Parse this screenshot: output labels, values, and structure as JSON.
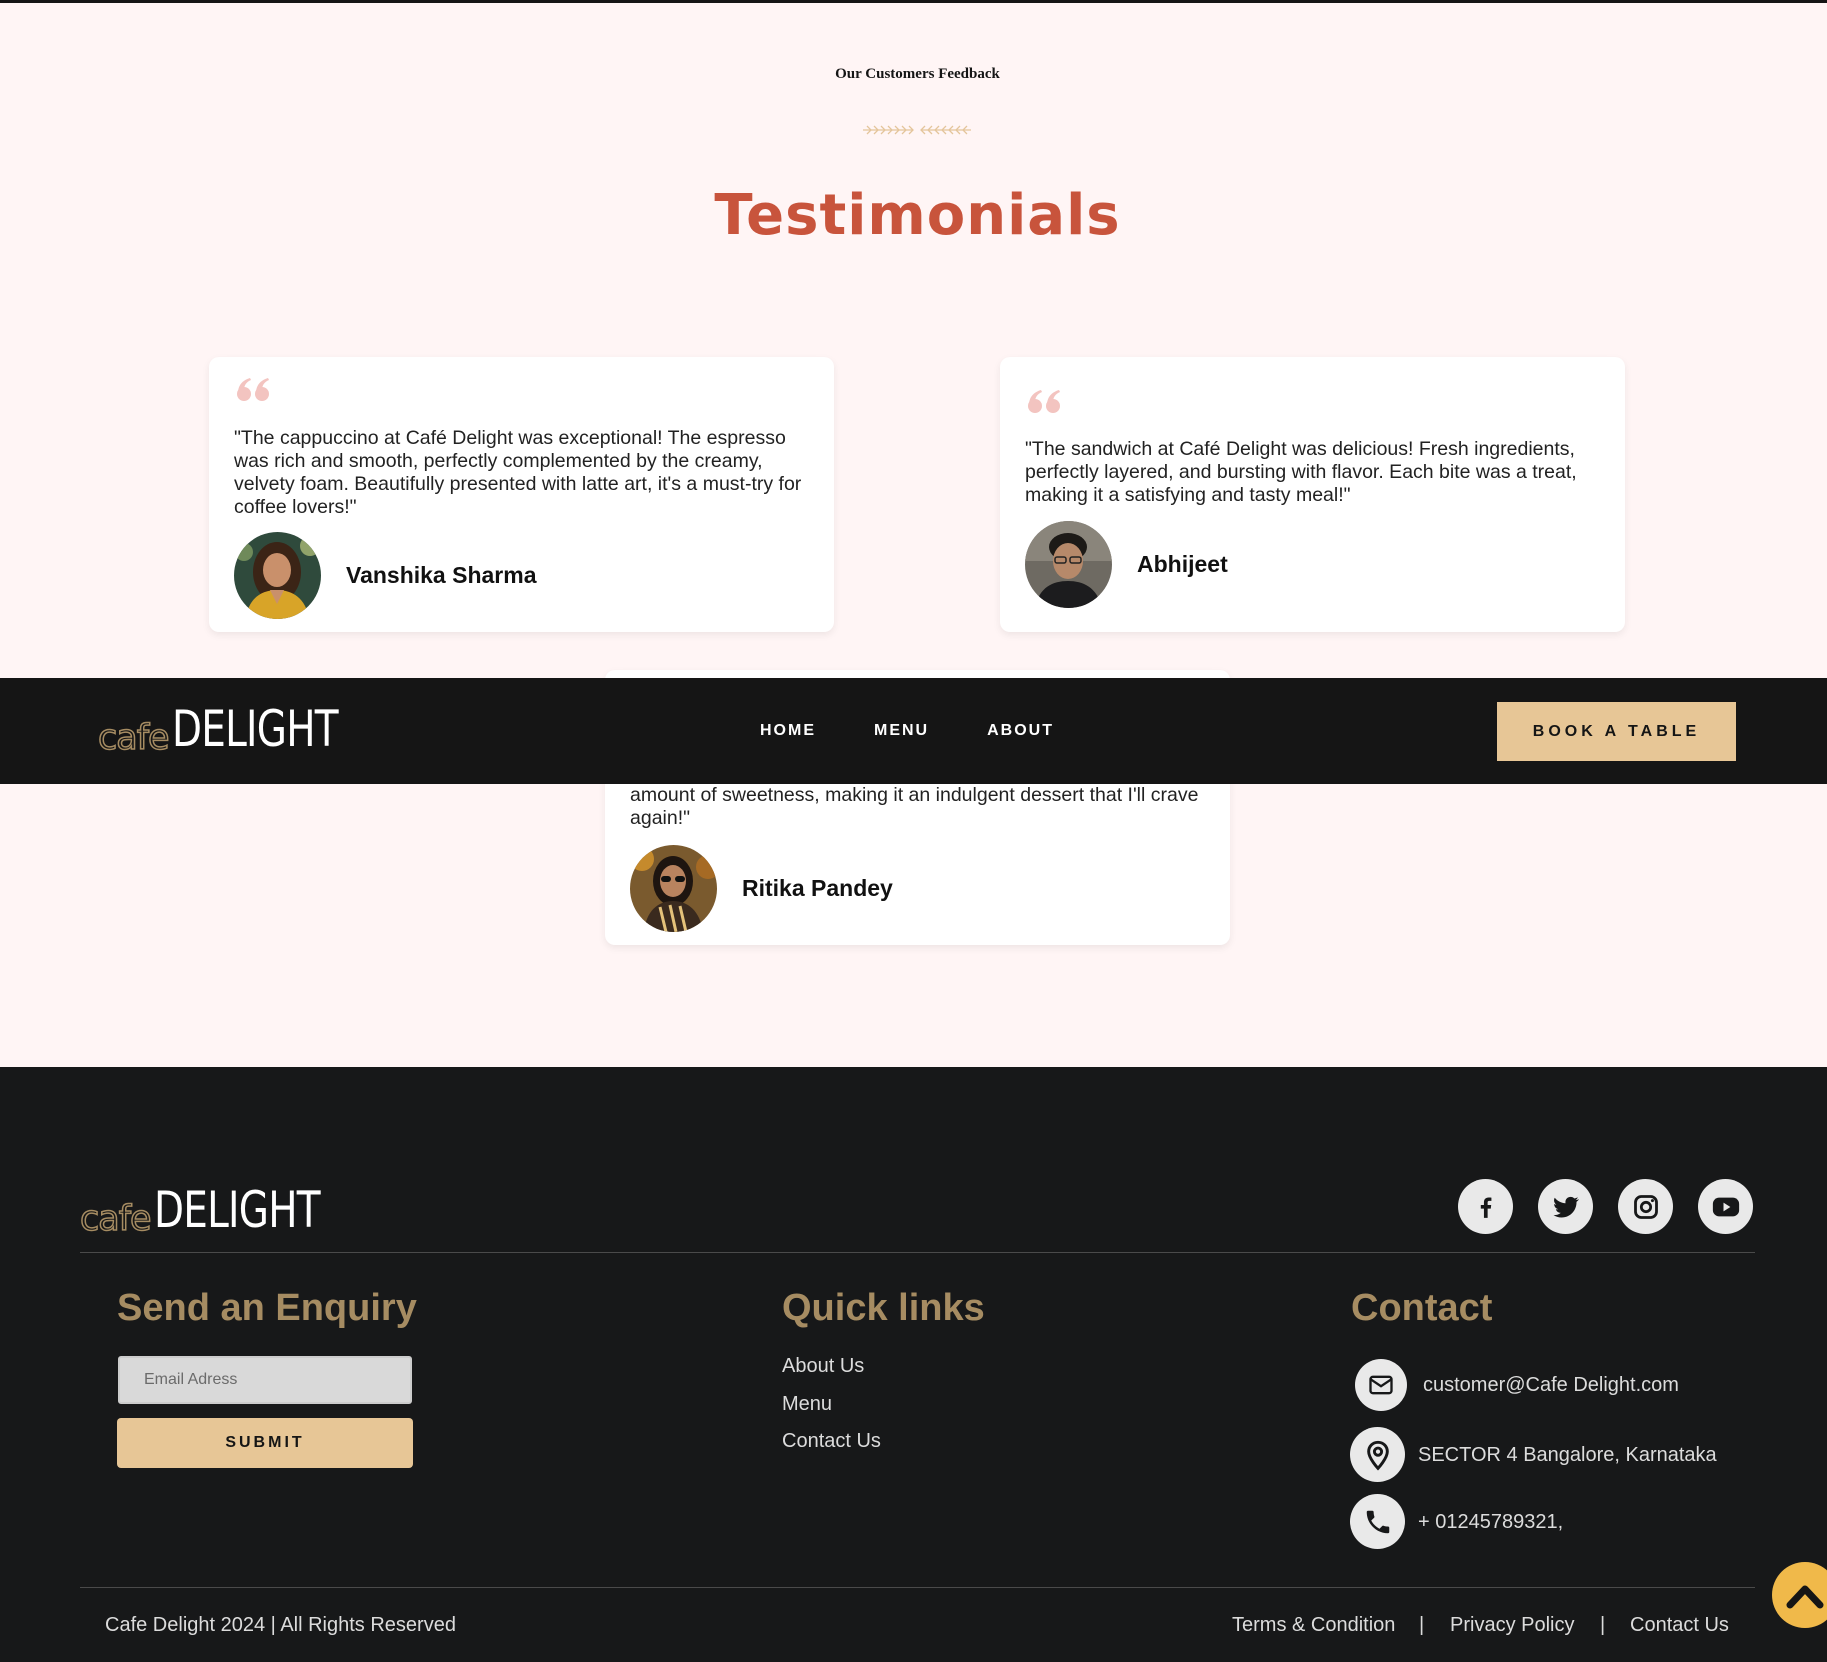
{
  "testimonials": {
    "eyebrow": "Our Customers Feedback",
    "title": "Testimonials",
    "cards": [
      {
        "quote": "\"The cappuccino at Café Delight was exceptional! The espresso was rich and smooth, perfectly complemented by the creamy, velvety foam. Beautifully presented with latte art, it's a must-try for coffee lovers!\"",
        "name": "Vanshika Sharma"
      },
      {
        "quote": "\"The sandwich at Café Delight was delicious! Fresh ingredients, perfectly layered, and bursting with flavor. Each bite was a treat, making it a satisfying and tasty meal!\"",
        "name": "Abhijeet"
      },
      {
        "quote": "amount of sweetness, making it an indulgent dessert that I'll crave again!\"",
        "name": "Ritika Pandey"
      }
    ]
  },
  "navbar": {
    "logo_cafe": "cafe",
    "logo_delight": "DELIGHT",
    "links": [
      "HOME",
      "MENU",
      "ABOUT"
    ],
    "cta": "BOOK A TABLE"
  },
  "footer": {
    "logo_cafe": "cafe",
    "logo_delight": "DELIGHT",
    "socials": [
      "facebook-icon",
      "twitter-icon",
      "instagram-icon",
      "youtube-icon"
    ],
    "enquiry": {
      "title": "Send an Enquiry",
      "placeholder": "Email Adress",
      "submit": "SUBMIT"
    },
    "quick_links": {
      "title": "Quick links",
      "items": [
        "About Us",
        "Menu",
        "Contact Us"
      ]
    },
    "contact": {
      "title": "Contact",
      "email": "customer@Cafe Delight.com",
      "address": "SECTOR 4 Bangalore, Karnataka",
      "phone": "+ 01245789321,"
    },
    "copyright": "Cafe Delight 2024 | All Rights Reserved",
    "legal": [
      "Terms & Condition",
      "Privacy Policy",
      "Contact Us"
    ],
    "separator": "|"
  },
  "colors": {
    "accent": "#c8543c",
    "gold": "#a68c62",
    "button": "#e7c696",
    "dark": "#151515",
    "section_bg": "#fff5f5",
    "scroll_top": "#f0b94a"
  }
}
